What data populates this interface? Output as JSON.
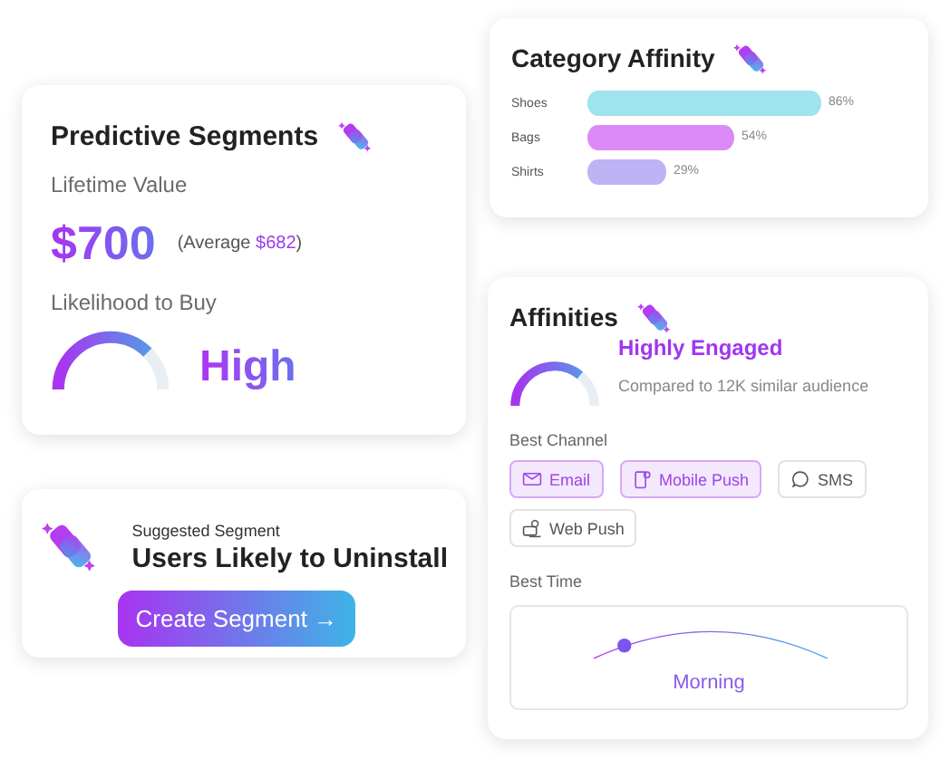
{
  "predictive": {
    "title": "Predictive Segments",
    "value_label": "Lifetime Value",
    "value": "$700",
    "average_prefix": "(Average",
    "average_value": "$682",
    "average_suffix": ")",
    "likelihood_label": "Likelihood to Buy",
    "likelihood": "High"
  },
  "category": {
    "title": "Category Affinity",
    "chart_data": {
      "type": "bar",
      "orientation": "horizontal",
      "categories": [
        "Shoes",
        "Bags",
        "Shirts"
      ],
      "values": [
        86,
        54,
        29
      ],
      "value_labels": [
        "86%",
        "54%",
        "29%"
      ]
    }
  },
  "suggested": {
    "caption": "Suggested Segment",
    "title": "Users Likely to Uninstall",
    "button": "Create Segment",
    "button_arrow": "→"
  },
  "affinities": {
    "title": "Affinities",
    "status": "Highly Engaged",
    "comparison": "Compared to 12K similar audience",
    "channel_label": "Best Channel",
    "channels": [
      {
        "label": "Email",
        "kind": "email",
        "selected": true
      },
      {
        "label": "Mobile Push",
        "kind": "mobile",
        "selected": true
      },
      {
        "label": "SMS",
        "kind": "chat",
        "selected": false
      },
      {
        "label": "Web Push",
        "kind": "web",
        "selected": false
      }
    ],
    "time_label": "Best Time",
    "time": "Morning"
  }
}
